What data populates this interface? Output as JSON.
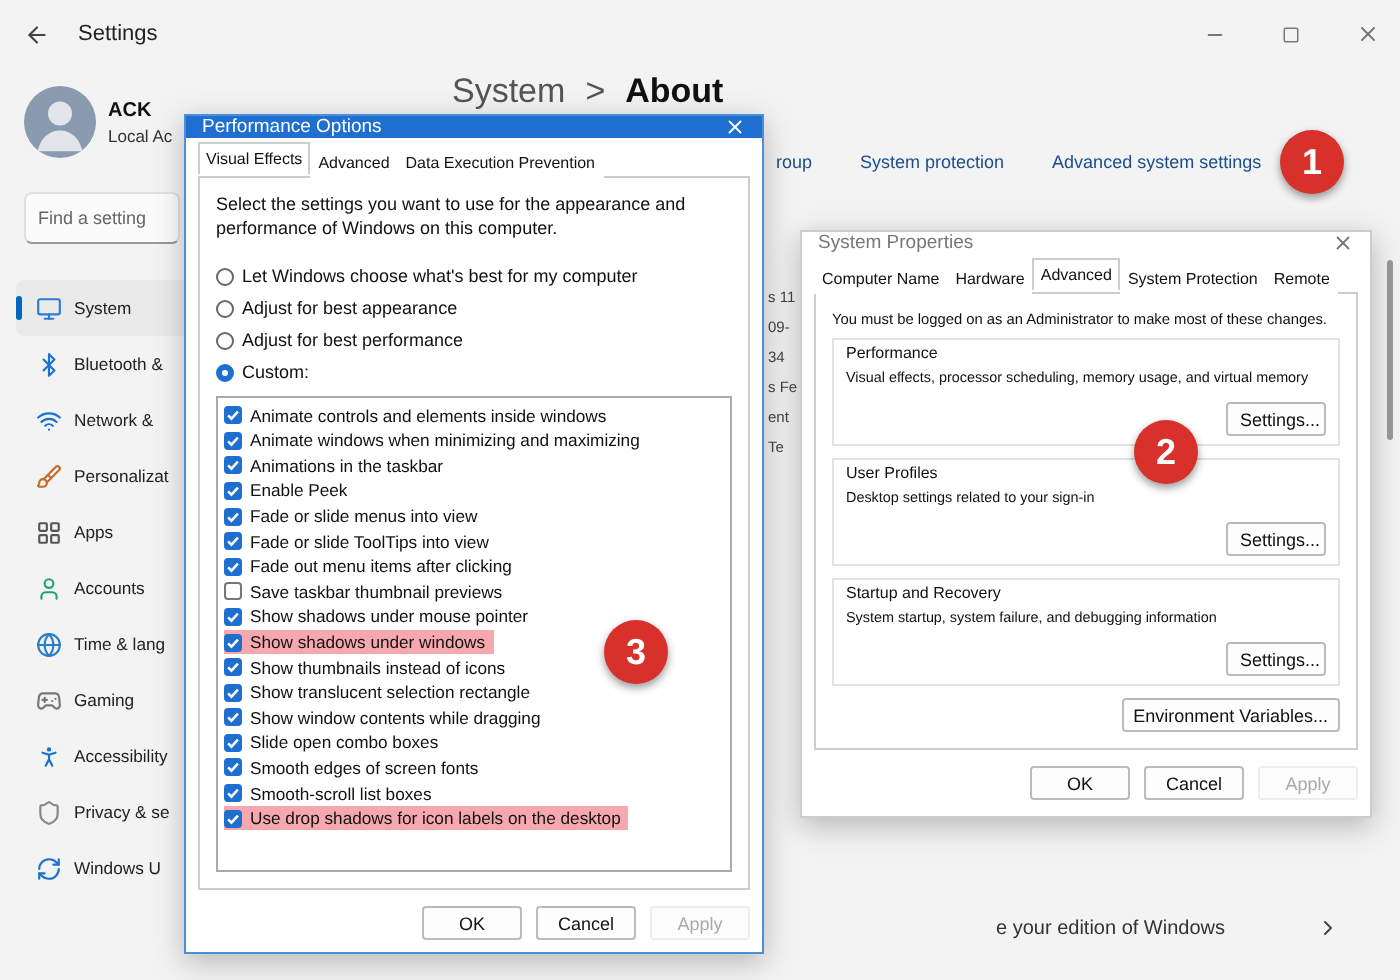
{
  "settings_window": {
    "title": "Settings",
    "user": {
      "name": "ACK",
      "account": "Local Ac"
    },
    "heading": {
      "parent": "System",
      "separator": ">",
      "current": "About"
    },
    "search": {
      "placeholder": "Find a setting"
    },
    "nav_items": [
      {
        "label": "System",
        "selected": true
      },
      {
        "label": "Bluetooth &",
        "selected": false
      },
      {
        "label": "Network &",
        "selected": false
      },
      {
        "label": "Personalizat",
        "selected": false
      },
      {
        "label": "Apps",
        "selected": false
      },
      {
        "label": "Accounts",
        "selected": false
      },
      {
        "label": "Time & lang",
        "selected": false
      },
      {
        "label": "Gaming",
        "selected": false
      },
      {
        "label": "Accessibility",
        "selected": false
      },
      {
        "label": "Privacy & se",
        "selected": false
      },
      {
        "label": "Windows U",
        "selected": false
      }
    ],
    "links": [
      "roup",
      "System protection",
      "Advanced system settings"
    ],
    "fragments": [
      "s 11",
      "09-",
      "34",
      "s Fe",
      "ent",
      "Te"
    ],
    "footer_text": "e your edition of Windows"
  },
  "performance_options": {
    "title": "Performance Options",
    "tabs": [
      {
        "label": "Visual Effects",
        "selected": true
      },
      {
        "label": "Advanced",
        "selected": false
      },
      {
        "label": "Data Execution Prevention",
        "selected": false
      }
    ],
    "description": "Select the settings you want to use for the appearance and performance of Windows on this computer.",
    "radios": [
      {
        "label": "Let Windows choose what's best for my computer",
        "selected": false
      },
      {
        "label": "Adjust for best appearance",
        "selected": false
      },
      {
        "label": "Adjust for best performance",
        "selected": false
      },
      {
        "label": "Custom:",
        "selected": true
      }
    ],
    "effects": [
      {
        "label": "Animate controls and elements inside windows",
        "checked": true,
        "highlighted": false
      },
      {
        "label": "Animate windows when minimizing and maximizing",
        "checked": true,
        "highlighted": false
      },
      {
        "label": "Animations in the taskbar",
        "checked": true,
        "highlighted": false
      },
      {
        "label": "Enable Peek",
        "checked": true,
        "highlighted": false
      },
      {
        "label": "Fade or slide menus into view",
        "checked": true,
        "highlighted": false
      },
      {
        "label": "Fade or slide ToolTips into view",
        "checked": true,
        "highlighted": false
      },
      {
        "label": "Fade out menu items after clicking",
        "checked": true,
        "highlighted": false
      },
      {
        "label": "Save taskbar thumbnail previews",
        "checked": false,
        "highlighted": false
      },
      {
        "label": "Show shadows under mouse pointer",
        "checked": true,
        "highlighted": false
      },
      {
        "label": "Show shadows under windows",
        "checked": true,
        "highlighted": true
      },
      {
        "label": "Show thumbnails instead of icons",
        "checked": true,
        "highlighted": false
      },
      {
        "label": "Show translucent selection rectangle",
        "checked": true,
        "highlighted": false
      },
      {
        "label": "Show window contents while dragging",
        "checked": true,
        "highlighted": false
      },
      {
        "label": "Slide open combo boxes",
        "checked": true,
        "highlighted": false
      },
      {
        "label": "Smooth edges of screen fonts",
        "checked": true,
        "highlighted": false
      },
      {
        "label": "Smooth-scroll list boxes",
        "checked": true,
        "highlighted": false
      },
      {
        "label": "Use drop shadows for icon labels on the desktop",
        "checked": true,
        "highlighted": true
      }
    ],
    "buttons": [
      {
        "label": "OK",
        "disabled": false
      },
      {
        "label": "Cancel",
        "disabled": false
      },
      {
        "label": "Apply",
        "disabled": true
      }
    ]
  },
  "system_properties": {
    "title": "System Properties",
    "tabs": [
      {
        "label": "Computer Name",
        "selected": false
      },
      {
        "label": "Hardware",
        "selected": false
      },
      {
        "label": "Advanced",
        "selected": true
      },
      {
        "label": "System Protection",
        "selected": false
      },
      {
        "label": "Remote",
        "selected": false
      }
    ],
    "notice": "You must be logged on as an Administrator to make most of these changes.",
    "groups": [
      {
        "title": "Performance",
        "description": "Visual effects, processor scheduling, memory usage, and virtual memory",
        "button": "Settings..."
      },
      {
        "title": "User Profiles",
        "description": "Desktop settings related to your sign-in",
        "button": "Settings..."
      },
      {
        "title": "Startup and Recovery",
        "description": "System startup, system failure, and debugging information",
        "button": "Settings..."
      }
    ],
    "extra_button": "Environment Variables...",
    "buttons": [
      {
        "label": "OK",
        "disabled": false
      },
      {
        "label": "Cancel",
        "disabled": false
      },
      {
        "label": "Apply",
        "disabled": true
      }
    ]
  },
  "callouts": [
    {
      "label": "1"
    },
    {
      "label": "2"
    },
    {
      "label": "3"
    }
  ]
}
